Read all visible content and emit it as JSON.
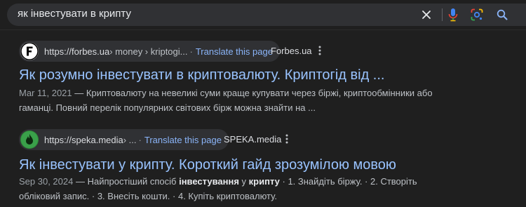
{
  "search": {
    "query": "як інвестувати в крипту",
    "icons": [
      "close-icon",
      "mic-icon",
      "lens-icon",
      "search-icon"
    ]
  },
  "colors": {
    "background": "#1f1f1f",
    "search_bar": "#303134",
    "link": "#99c3ff",
    "translate_link": "#8ab4f8"
  },
  "results": [
    {
      "favicon_icon": "forbes-f-icon",
      "url_domain": "https://forbes.ua",
      "url_path": " › money › kriptogi...",
      "translate_label": "Translate this page",
      "source_name": "Forbes.ua",
      "title": "Як розумно інвестувати в криптовалюту. Криптогід від ...",
      "date": "Mar 11, 2021",
      "snippet_line1": " — Криптовалюту на невеликі суми краще купувати через біржі, криптообмінники або",
      "snippet_line2": "гаманці. Повний перелік популярних світових бірж можна знайти на ..."
    },
    {
      "favicon_icon": "speka-flame-icon",
      "url_domain": "https://speka.media",
      "url_path": " › ...",
      "translate_label": "Translate this page",
      "source_name": "SPEKA.media",
      "title": "Як інвестувати у крипту. Короткий гайд зрозумілою мовою",
      "date": "Sep 30, 2024",
      "snippet_pre": " — Найпростіший спосіб ",
      "snippet_bold1": "інвестування",
      "snippet_mid": " у ",
      "snippet_bold2": "крипту",
      "snippet_post": " · 1. Знайдіть біржу. · 2. Створіть",
      "snippet_line2": "обліковий запис. · 3. Внесіть кошти. · 4. Купіть криптовалюту."
    }
  ]
}
